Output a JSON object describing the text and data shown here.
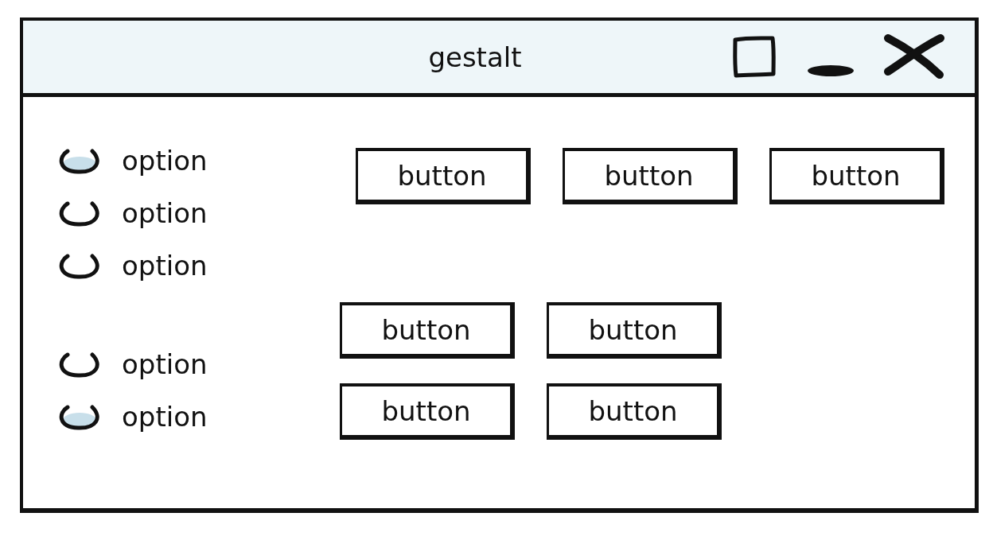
{
  "window": {
    "title": "gestalt"
  },
  "radio_groups": [
    {
      "options": [
        {
          "label": "option",
          "selected": true
        },
        {
          "label": "option",
          "selected": false
        },
        {
          "label": "option",
          "selected": false
        }
      ]
    },
    {
      "options": [
        {
          "label": "option",
          "selected": false
        },
        {
          "label": "option",
          "selected": true
        }
      ]
    }
  ],
  "button_groups": [
    {
      "rows": [
        [
          "button",
          "button",
          "button"
        ]
      ]
    },
    {
      "rows": [
        [
          "button",
          "button"
        ],
        [
          "button",
          "button"
        ]
      ]
    }
  ]
}
